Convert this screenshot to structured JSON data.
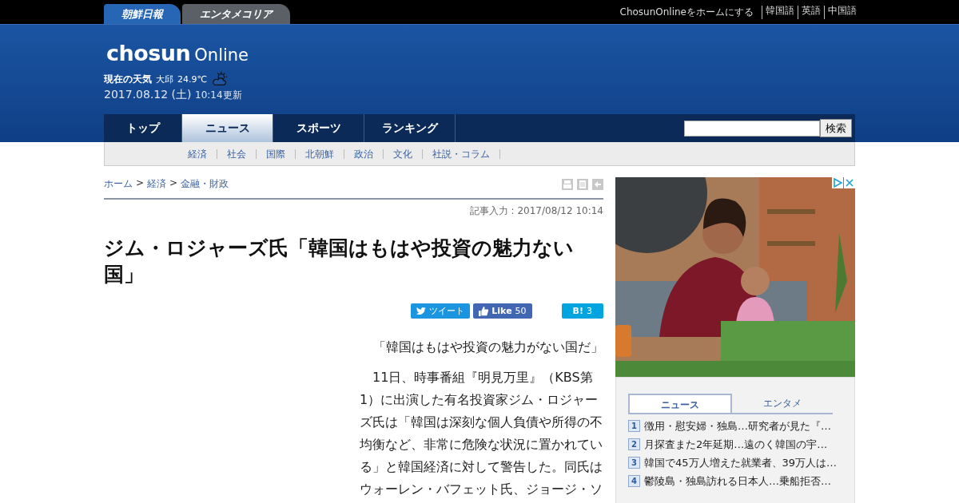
{
  "site_tabs": [
    {
      "label": "朝鮮日報",
      "selected": true
    },
    {
      "label": "エンタメコリア",
      "selected": false
    }
  ],
  "top_links": [
    "ChosunOnlineをホームにする",
    "韓国語",
    "英語",
    "中国語"
  ],
  "logo": {
    "brand": "chosun",
    "suffix": "Online"
  },
  "weather": {
    "label": "現在の天気",
    "city": "大邱",
    "temp": "24.9℃"
  },
  "updated": {
    "date": "2017.08.12 (土)",
    "time": "10:14更新"
  },
  "nav": [
    {
      "label": "トップ",
      "selected": false
    },
    {
      "label": "ニュース",
      "selected": true
    },
    {
      "label": "スポーツ",
      "selected": false
    },
    {
      "label": "ランキング",
      "selected": false
    }
  ],
  "search": {
    "button": "検索"
  },
  "subnav": [
    "経済",
    "社会",
    "国際",
    "北朝鮮",
    "政治",
    "文化",
    "社説・コラム"
  ],
  "breadcrumb": {
    "separator": ">",
    "links": [
      "ホーム",
      "経済",
      "金融・財政"
    ]
  },
  "article": {
    "timestamp": "記事入力 : 2017/08/12 10:14",
    "title": "ジム・ロジャーズ氏「韓国はもはや投資の魅力ない国」",
    "share": {
      "tweet": "ツイート",
      "like": "Like",
      "like_count": "50",
      "hatena": "B!",
      "hatena_count": "3"
    },
    "lead": "「韓国はもはや投資の魅力がない国だ」",
    "body": "11日、時事番組『明見万里』（KBS第1）に出演した有名投資家ジム・ロジャーズ氏は「韓国は深刻な個人負債や所得の不均衡など、非常に危険な状況に置かれている」と韓国経済に対して警告した。同氏はウォーレン・バフェット氏、ジョージ・ソ"
  },
  "ranking": {
    "tabs": [
      {
        "label": "ニュース",
        "selected": true
      },
      {
        "label": "エンタメ",
        "selected": false
      }
    ],
    "items": [
      {
        "rank": "1",
        "title": "徴用・慰安婦・独島…研究者が見た『…"
      },
      {
        "rank": "2",
        "title": "月探査また2年延期…遠のく韓国の宇…"
      },
      {
        "rank": "3",
        "title": "韓国で45万人増えた就業者、39万人は…"
      },
      {
        "rank": "4",
        "title": "鬱陵島・独島訪れる日本人…乗船拒否…"
      }
    ]
  }
}
